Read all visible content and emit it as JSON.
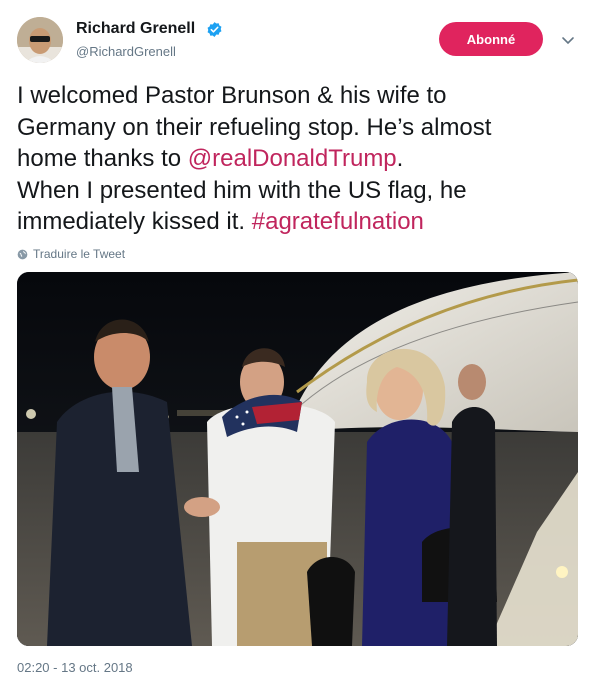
{
  "author": {
    "name": "Richard Grenell",
    "handle": "@RichardGrenell",
    "verified": true,
    "avatar_icon": "profile-photo"
  },
  "follow_button": {
    "label": "Abonné",
    "color": "#e0245e"
  },
  "more_menu_icon": "chevron-down-icon",
  "tweet": {
    "lines": [
      {
        "text": "I welcomed Pastor Brunson & his wife to"
      },
      {
        "text": "Germany on their refueling stop. He’s almost"
      },
      {
        "text": "home thanks to ",
        "link": "@realDonaldTrump",
        "after": "."
      },
      {
        "text": "When I presented him with the US flag, he"
      },
      {
        "text": "immediately kissed it. ",
        "link": "#agratefulnation"
      }
    ],
    "link_color": "#c0255d"
  },
  "translate": {
    "label": "Traduire le Tweet",
    "icon": "globe-icon"
  },
  "media": {
    "kind": "photo",
    "icon": "tweet-photo"
  },
  "timestamp": "02:20 - 13 oct. 2018"
}
